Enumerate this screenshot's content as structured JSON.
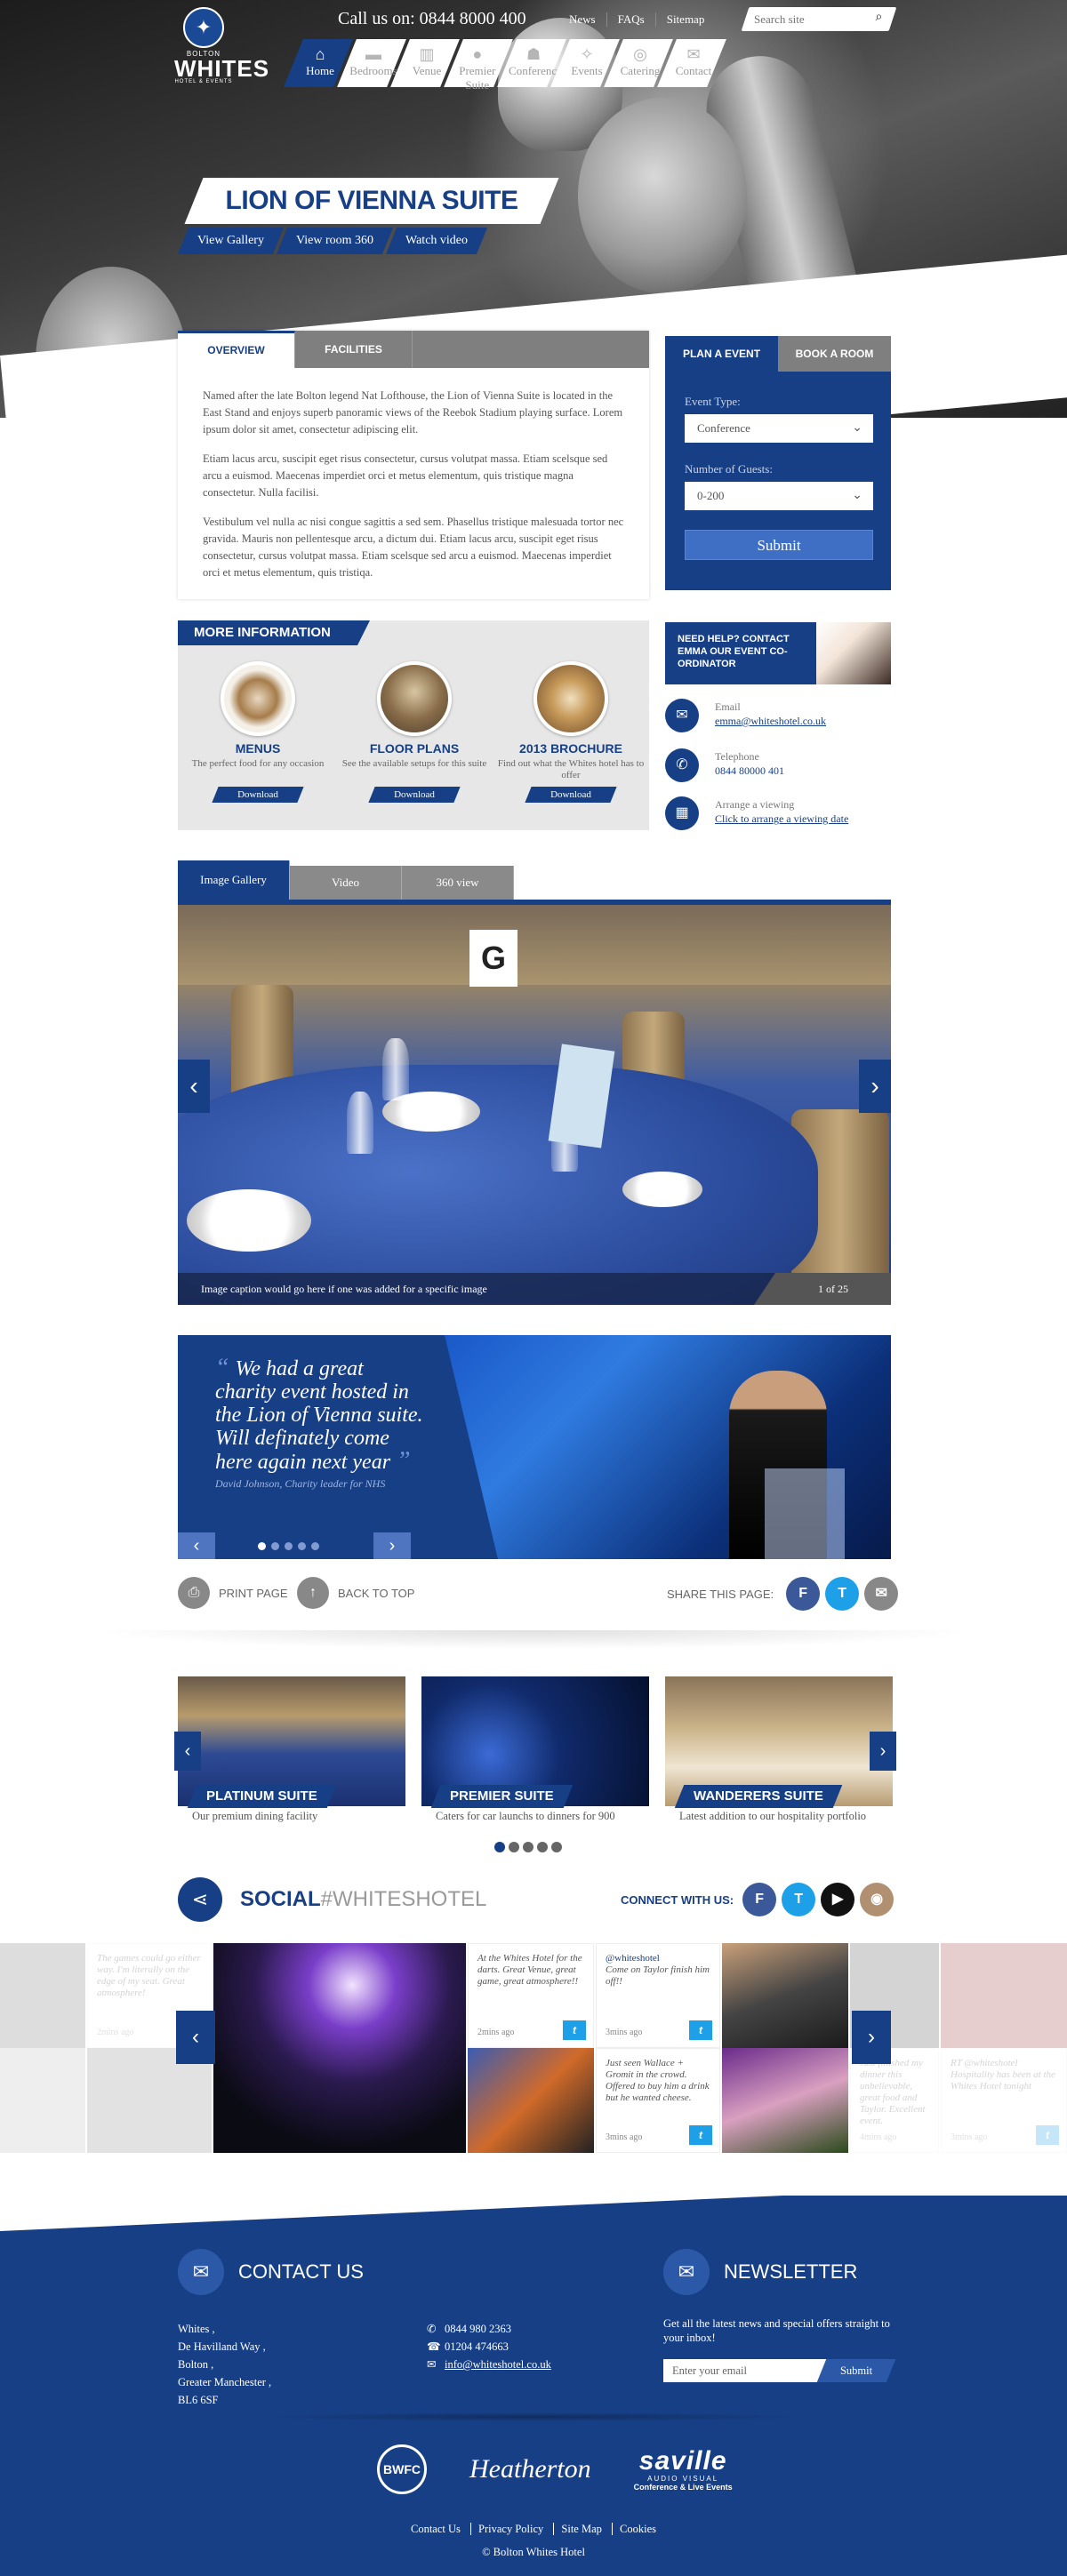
{
  "header": {
    "logo": {
      "small": "BOLTON",
      "name": "WHITES",
      "tagline": "HOTEL & EVENTS"
    },
    "call_us": "Call us on: 0844 8000 400",
    "top_links": [
      "News",
      "FAQs",
      "Sitemap"
    ],
    "search_placeholder": "Search site"
  },
  "nav": [
    {
      "label": "Home",
      "icon": "home-icon",
      "active": true
    },
    {
      "label": "Bedrooms",
      "icon": "bed-icon",
      "active": false
    },
    {
      "label": "Venue",
      "icon": "venue-icon",
      "active": false
    },
    {
      "label": "Premier Suite",
      "icon": "premier-icon",
      "active": false
    },
    {
      "label": "Conferences",
      "icon": "conference-icon",
      "active": false
    },
    {
      "label": "Events",
      "icon": "events-icon",
      "active": false
    },
    {
      "label": "Catering",
      "icon": "catering-icon",
      "active": false
    },
    {
      "label": "Contact",
      "icon": "contact-icon",
      "active": false
    }
  ],
  "hero": {
    "title": "LION OF VIENNA SUITE",
    "buttons": [
      "View Gallery",
      "View room 360",
      "Watch video"
    ]
  },
  "overview": {
    "tabs": [
      "OVERVIEW",
      "FACILITIES"
    ],
    "paragraphs": [
      "Named after the late Bolton legend Nat Lofthouse, the Lion of Vienna Suite is located in the East Stand and enjoys superb panoramic views of the Reebok Stadium playing surface.  Lorem ipsum dolor sit amet, consectetur adipiscing elit.",
      "Etiam lacus arcu, suscipit eget risus consectetur, cursus volutpat massa. Etiam scelsque sed arcu a euismod. Maecenas imperdiet orci et metus elementum, quis tristique magna consectetur. Nulla facilisi.",
      "Vestibulum vel nulla ac nisi congue sagittis a sed sem. Phasellus tristique malesuada tortor nec gravida. Mauris non pellentesque arcu, a dictum dui. Etiam lacus arcu, suscipit eget risus consectetur, cursus volutpat massa. Etiam scelsque sed arcu a euismod. Maecenas imperdiet orci et metus elementum, quis tristiqa."
    ]
  },
  "plan": {
    "tabs": [
      "PLAN A EVENT",
      "BOOK A ROOM"
    ],
    "event_type_label": "Event Type:",
    "event_type_value": "Conference",
    "guests_label": "Number of Guests:",
    "guests_value": "0-200",
    "submit": "Submit"
  },
  "more_info": {
    "title": "MORE INFORMATION",
    "items": [
      {
        "title": "MENUS",
        "desc": "The perfect food for any occasion",
        "button": "Download"
      },
      {
        "title": "FLOOR PLANS",
        "desc": "See the available setups for this suite",
        "button": "Download"
      },
      {
        "title": "2013 BROCHURE",
        "desc": "Find out what the Whites hotel has to offer",
        "button": "Download"
      }
    ]
  },
  "help": {
    "title": "NEED HELP? CONTACT EMMA OUR EVENT CO-ORDINATOR",
    "rows": [
      {
        "label": "Email",
        "value": "emma@whiteshotel.co.uk",
        "icon": "mail-icon"
      },
      {
        "label": "Telephone",
        "value": "0844 80000 401",
        "icon": "phone-icon"
      },
      {
        "label": "Arrange a viewing",
        "value": "Click to arrange a viewing date",
        "icon": "calendar-icon"
      }
    ]
  },
  "gallery": {
    "tabs": [
      "Image Gallery",
      "Video",
      "360 view"
    ],
    "caption": "Image caption would go here if one was added for a specific image",
    "counter": "1 of 25",
    "sign": "G"
  },
  "testimonial": {
    "quote": "We had a great charity event hosted in the Lion of Vienna suite. Will definately come here again next year",
    "author": "David Johnson, Charity leader for NHS",
    "dots": 5,
    "active_dot": 1
  },
  "utility": {
    "print": "PRINT PAGE",
    "back_to_top": "BACK TO TOP",
    "share": "SHARE THIS PAGE:"
  },
  "suites": [
    {
      "title": "PLATINUM SUITE",
      "desc": "Our premium dining facility"
    },
    {
      "title": "PREMIER SUITE",
      "desc": "Caters for car launchs to dinners for 900"
    },
    {
      "title": "WANDERERS SUITE",
      "desc": "Latest addition to our hospitality portfolio"
    }
  ],
  "suite_dots": {
    "count": 5,
    "active": 1
  },
  "social": {
    "title_bold": "SOCIAL",
    "title_hash": "#WHITESHOTEL",
    "connect": "CONNECT WITH US:",
    "posts": [
      {
        "text": "The games could go either way. I'm literally on the edge of my seat. Great atmosphere!",
        "ago": "2mins ago"
      },
      {
        "text": "At the Whites Hotel for the darts. Great Venue, great game, great atmosphere!!",
        "ago": "2mins ago"
      },
      {
        "handle": "@whiteshotel",
        "text": "Come on Taylor finish him off!!",
        "ago": "3mins ago"
      },
      {
        "text": "Just seen Wallace + Gromit in the crowd. Offered to buy him a drink but he wanted cheese.",
        "ago": "3mins ago"
      },
      {
        "text": "Just finished my dinner this unbelievable, great food and Taylor. Excellent event.",
        "ago": "4mins ago"
      },
      {
        "text": "RT @whiteshotel Hospitality has been at the Whites Hotel tonight",
        "ago": "3mins ago"
      }
    ]
  },
  "footer": {
    "contact_title": "CONTACT US",
    "address": [
      "Whites ,",
      "De Havilland Way ,",
      "Bolton ,",
      "Greater Manchester ,",
      "BL6 6SF"
    ],
    "phones": [
      "0844 980 2363",
      "01204 474663",
      "info@whiteshotel.co.uk"
    ],
    "newsletter_title": "NEWSLETTER",
    "newsletter_text": "Get all the latest news and special offers straight to your inbox!",
    "newsletter_placeholder": "Enter your email",
    "newsletter_submit": "Submit",
    "logos": {
      "bwfc": "BWFC",
      "heatherton": "Heatherton",
      "saville": "saville",
      "saville_sub": "AUDIO VISUAL",
      "saville_tag": "Conference & Live Events"
    },
    "links": [
      "Contact Us",
      "Privacy Policy",
      "Site Map",
      "Cookies"
    ],
    "copyright": "© Bolton Whites Hotel"
  }
}
